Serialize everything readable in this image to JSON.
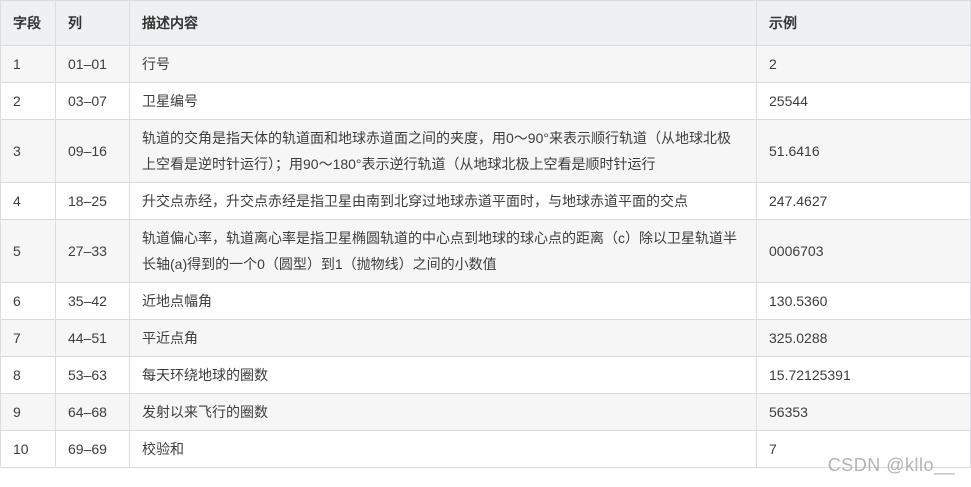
{
  "table": {
    "headers": [
      {
        "key": "field",
        "label": "字段"
      },
      {
        "key": "col",
        "label": "列"
      },
      {
        "key": "desc",
        "label": "描述内容"
      },
      {
        "key": "example",
        "label": "示例"
      }
    ],
    "rows": [
      {
        "field": "1",
        "col": "01–01",
        "desc": "行号",
        "example": "2"
      },
      {
        "field": "2",
        "col": "03–07",
        "desc": "卫星编号",
        "example": "25544"
      },
      {
        "field": "3",
        "col": "09–16",
        "desc": "轨道的交角是指天体的轨道面和地球赤道面之间的夹度，用0～90°来表示顺行轨道（从地球北极上空看是逆时针运行）；用90～180°表示逆行轨道（从地球北极上空看是顺时针运行",
        "example": "51.6416"
      },
      {
        "field": "4",
        "col": "18–25",
        "desc": "升交点赤经，升交点赤经是指卫星由南到北穿过地球赤道平面时，与地球赤道平面的交点",
        "example": "247.4627"
      },
      {
        "field": "5",
        "col": "27–33",
        "desc": "轨道偏心率，轨道离心率是指卫星椭圆轨道的中心点到地球的球心点的距离（c）除以卫星轨道半长轴(a)得到的一个0（圆型）到1（抛物线）之间的小数值",
        "example": "0006703"
      },
      {
        "field": "6",
        "col": "35–42",
        "desc": "近地点幅角",
        "example": "130.5360"
      },
      {
        "field": "7",
        "col": "44–51",
        "desc": "平近点角",
        "example": "325.0288"
      },
      {
        "field": "8",
        "col": "53–63",
        "desc": "每天环绕地球的圈数",
        "example": "15.72125391"
      },
      {
        "field": "9",
        "col": "64–68",
        "desc": "发射以来飞行的圈数",
        "example": "56353"
      },
      {
        "field": "10",
        "col": "69–69",
        "desc": "校验和",
        "example": "7"
      }
    ]
  },
  "watermark": "CSDN @kllo__",
  "colors": {
    "header_bg": "#eef0f2",
    "odd_row_bg": "#f6f6f7",
    "even_row_bg": "#ffffff",
    "border": "#d9dbde",
    "text": "#3d3d3d",
    "watermark": "#b4b4b4"
  }
}
